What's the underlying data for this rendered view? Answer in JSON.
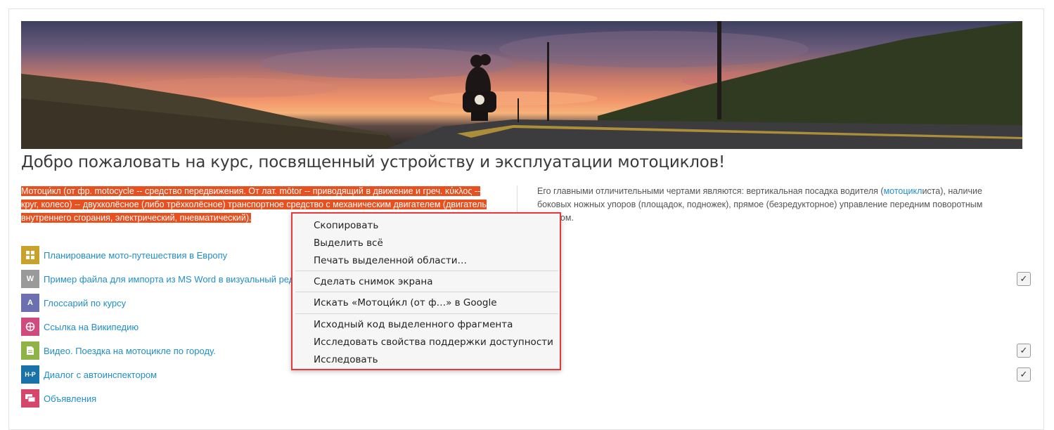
{
  "banner": {
    "alt": ""
  },
  "page": {
    "title": "Добро пожаловать на курс, посвященный устройству и эксплуатации мотоциклов!"
  },
  "intro": {
    "left_text": "Мотоци́кл (от фр. motocycle -- средство передвижения. От лат. mōtor -- приводящий в движение и греч. κύκλος -- круг, колесо) -- двухколёсное (либо трёхколёсное) транспортное средство с механическим двигателем (двигатель внутреннего сгорания, электрический, пневматический).",
    "right_before": "Его главными отличительными чертами являются: вертикальная посадка водителя (",
    "right_link": "мотоцикл",
    "right_after": "иста), наличие боковых ножных упоров (площадок, подножек), прямое (безредукторное) управление передним поворотным колесом."
  },
  "activities": [
    {
      "label": "Планирование мото-путешествия в Европу",
      "icon": "puzzle-icon",
      "icon_text": "",
      "color": "#c9a22b"
    },
    {
      "label": "Пример файла для импорта из MS Word в визуальный редактор",
      "icon": "word-doc-icon",
      "icon_text": "W",
      "color": "#8a8a8a"
    },
    {
      "label": "Глоссарий по курсу",
      "icon": "glossary-icon",
      "icon_text": "A",
      "color": "#6c6fb0"
    },
    {
      "label": "Ссылка на Википедию",
      "icon": "url-icon",
      "icon_text": "",
      "color": "#d04a7e"
    },
    {
      "label": "Видео. Поездка на мотоцикле по городу.",
      "icon": "file-icon",
      "icon_text": "",
      "color": "#8fb346"
    },
    {
      "label": "Диалог с автоинспектором",
      "icon": "h5p-icon",
      "icon_text": "H-P",
      "color": "#1a73a8"
    },
    {
      "label": "Объявления",
      "icon": "forum-icon",
      "icon_text": "",
      "color": "#d5466a"
    }
  ],
  "checkbox_symbol": "✓",
  "context_menu": {
    "items": [
      "Скопировать",
      "Выделить всё",
      "Печать выделенной области…",
      "Сделать снимок экрана",
      "Искать «Мотоци́кл (от ф…» в Google",
      "Исходный код выделенного фрагмента",
      "Исследовать свойства поддержки доступности",
      "Исследовать"
    ],
    "border_color": "#e33b3b"
  },
  "colors": {
    "link": "#1f8fc7",
    "selection": "#e8501f",
    "title": "#3a3a3a"
  }
}
